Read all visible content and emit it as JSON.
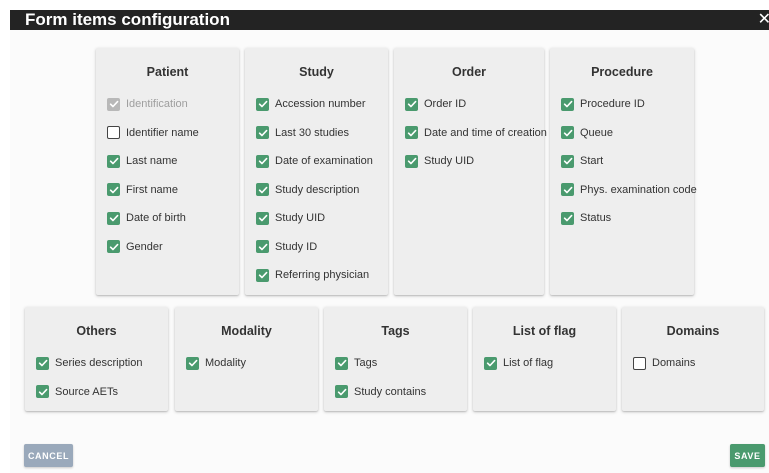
{
  "dialog": {
    "title": "Form items configuration",
    "close_glyph": "✕"
  },
  "colors": {
    "checked": "#4a9a6e",
    "disabled": "#b8b8b8",
    "cancel": "#9aa9bb",
    "save": "#4a9a6e"
  },
  "groups": [
    {
      "title": "Patient",
      "items": [
        {
          "label": "Identification",
          "checked": true,
          "disabled": true
        },
        {
          "label": "Identifier name",
          "checked": false
        },
        {
          "label": "Last name",
          "checked": true
        },
        {
          "label": "First name",
          "checked": true
        },
        {
          "label": "Date of birth",
          "checked": true
        },
        {
          "label": "Gender",
          "checked": true
        }
      ]
    },
    {
      "title": "Study",
      "items": [
        {
          "label": "Accession number",
          "checked": true
        },
        {
          "label": "Last 30 studies",
          "checked": true
        },
        {
          "label": "Date of examination",
          "checked": true
        },
        {
          "label": "Study description",
          "checked": true
        },
        {
          "label": "Study UID",
          "checked": true
        },
        {
          "label": "Study ID",
          "checked": true
        },
        {
          "label": "Referring physician",
          "checked": true
        }
      ]
    },
    {
      "title": "Order",
      "items": [
        {
          "label": "Order ID",
          "checked": true
        },
        {
          "label": "Date and time of creation",
          "checked": true
        },
        {
          "label": "Study UID",
          "checked": true
        }
      ]
    },
    {
      "title": "Procedure",
      "items": [
        {
          "label": "Procedure ID",
          "checked": true
        },
        {
          "label": "Queue",
          "checked": true
        },
        {
          "label": "Start",
          "checked": true
        },
        {
          "label": "Phys. examination code",
          "checked": true
        },
        {
          "label": "Status",
          "checked": true
        }
      ]
    },
    {
      "title": "Others",
      "items": [
        {
          "label": "Series description",
          "checked": true
        },
        {
          "label": "Source AETs",
          "checked": true
        }
      ]
    },
    {
      "title": "Modality",
      "items": [
        {
          "label": "Modality",
          "checked": true
        }
      ]
    },
    {
      "title": "Tags",
      "items": [
        {
          "label": "Tags",
          "checked": true
        },
        {
          "label": "Study contains",
          "checked": true
        }
      ]
    },
    {
      "title": "List of flag",
      "items": [
        {
          "label": "List of flag",
          "checked": true
        }
      ]
    },
    {
      "title": "Domains",
      "items": [
        {
          "label": "Domains",
          "checked": false
        }
      ]
    }
  ],
  "buttons": {
    "cancel_label": "CANCEL",
    "save_label": "SAVE"
  }
}
